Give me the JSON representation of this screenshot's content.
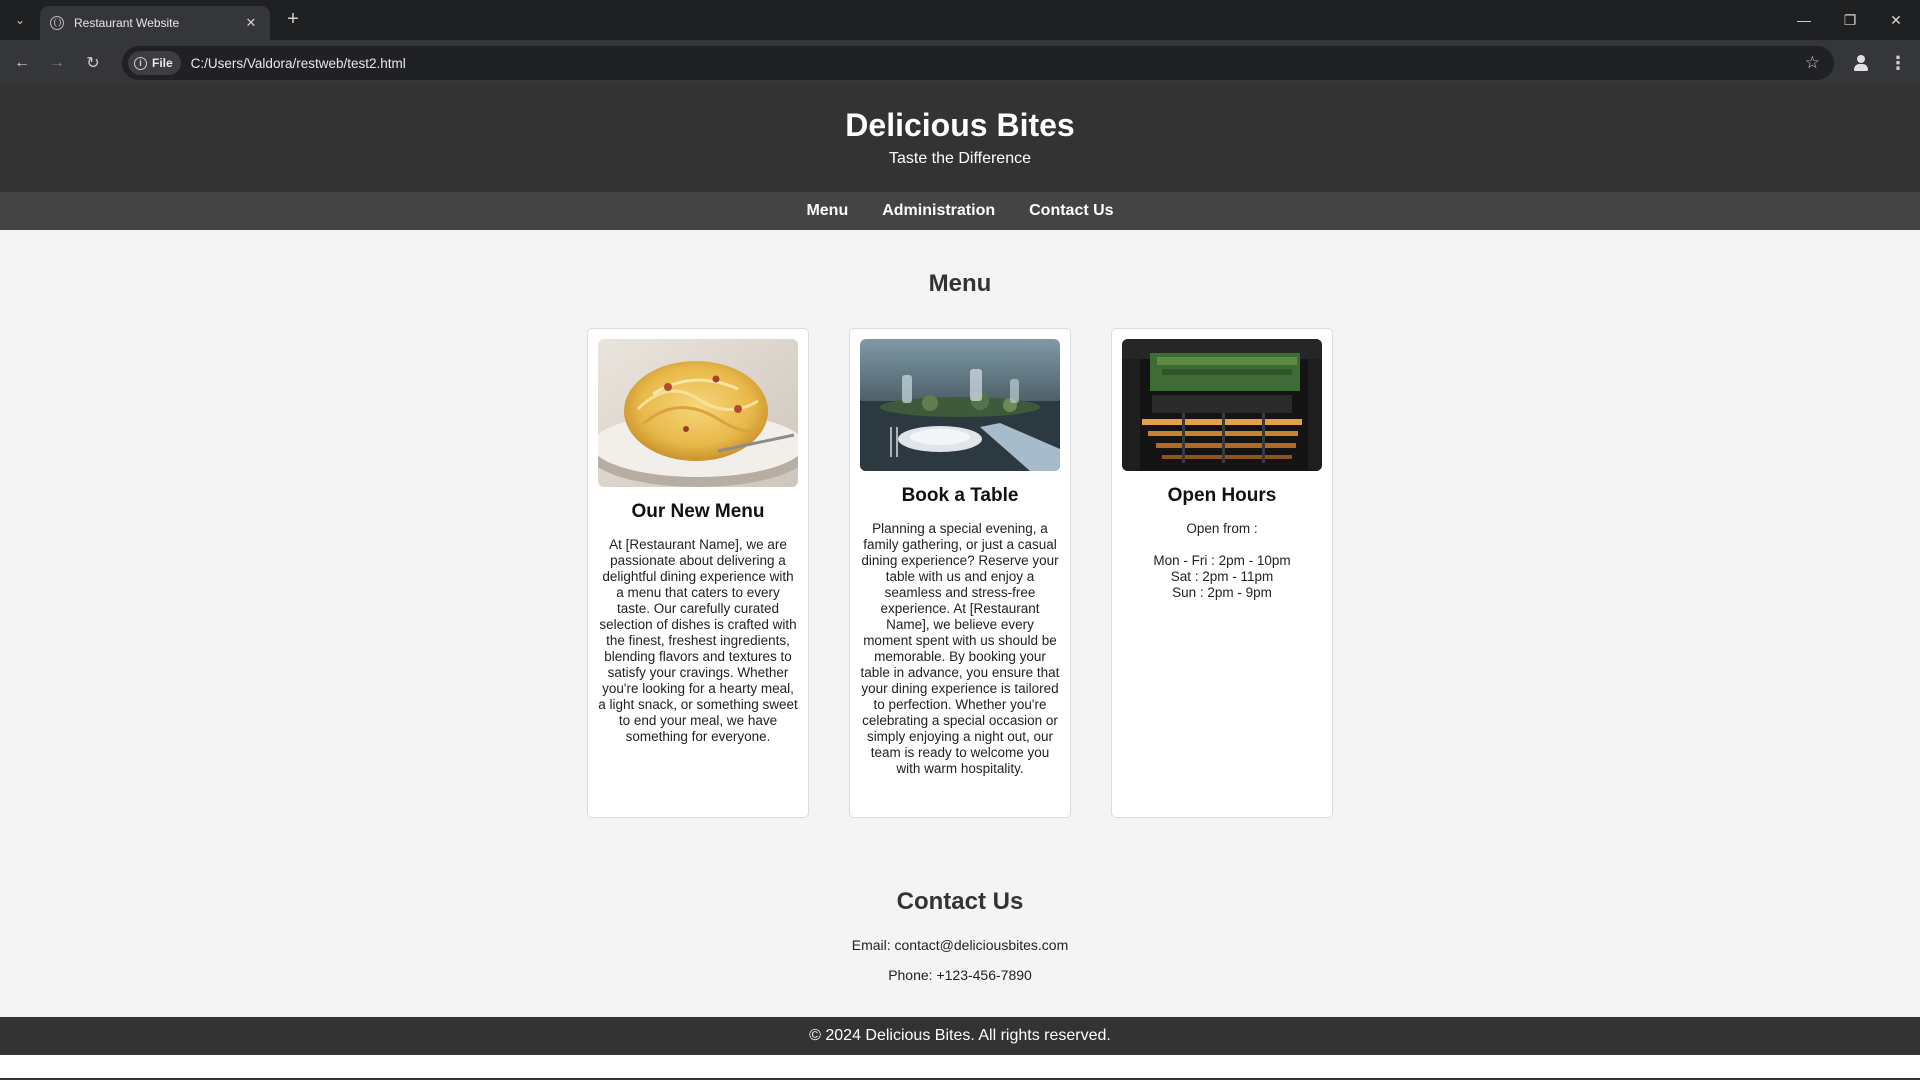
{
  "browser": {
    "tab_title": "Restaurant Website",
    "site_chip": "File",
    "url": "C:/Users/Valdora/restweb/test2.html"
  },
  "header": {
    "title": "Delicious Bites",
    "tagline": "Taste the Difference"
  },
  "nav": {
    "items": [
      "Menu",
      "Administration",
      "Contact Us"
    ]
  },
  "menu_section": {
    "title": "Menu",
    "cards": [
      {
        "title": "Our New Menu",
        "text": "At [Restaurant Name], we are passionate about delivering a delightful dining experience with a menu that caters to every taste. Our carefully curated selection of dishes is crafted with the finest, freshest ingredients, blending flavors and textures to satisfy your cravings. Whether you're looking for a hearty meal, a light snack, or something sweet to end your meal, we have something for everyone."
      },
      {
        "title": "Book a Table",
        "text": "Planning a special evening, a family gathering, or just a casual dining experience? Reserve your table with us and enjoy a seamless and stress-free experience. At [Restaurant Name], we believe every moment spent with us should be memorable. By booking your table in advance, you ensure that your dining experience is tailored to perfection. Whether you're celebrating a special occasion or simply enjoying a night out, our team is ready to welcome you with warm hospitality."
      },
      {
        "title": "Open Hours",
        "intro": "Open from :",
        "hours": [
          "Mon - Fri : 2pm - 10pm",
          "Sat : 2pm - 11pm",
          "Sun : 2pm - 9pm"
        ]
      }
    ]
  },
  "contact": {
    "title": "Contact Us",
    "email": "Email: contact@deliciousbites.com",
    "phone": "Phone: +123-456-7890"
  },
  "footer": {
    "text": "© 2024 Delicious Bites. All rights reserved."
  },
  "colors": {
    "header_bg": "#333333",
    "nav_bg": "#444444",
    "page_bg": "#f4f4f4"
  }
}
